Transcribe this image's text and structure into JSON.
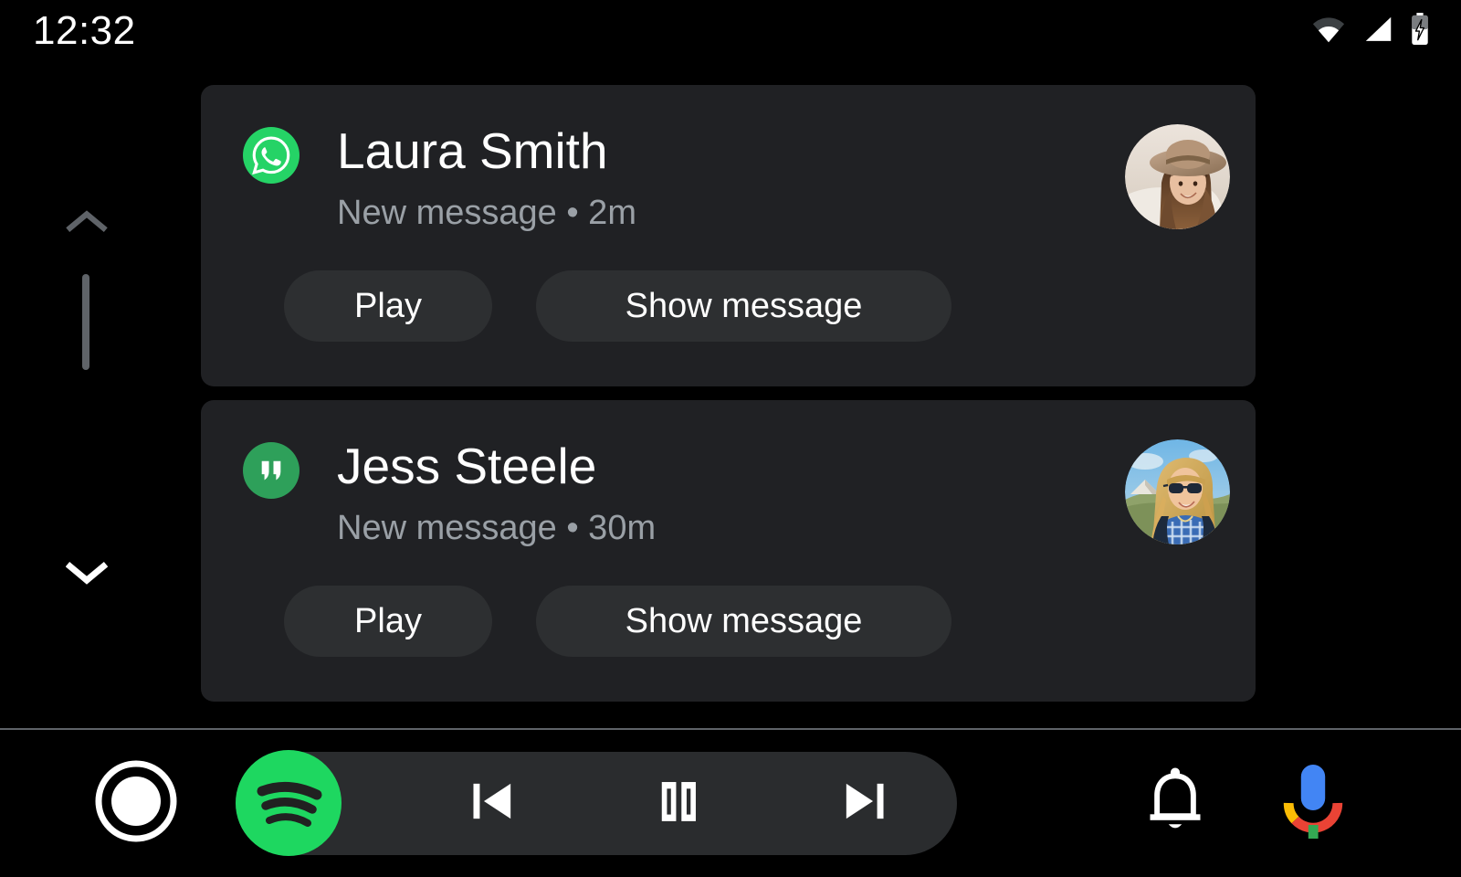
{
  "status_bar": {
    "clock": "12:32",
    "icons": [
      {
        "name": "wifi-icon",
        "label": "Wi-Fi"
      },
      {
        "name": "cellular-signal-icon",
        "label": "Cellular signal"
      },
      {
        "name": "battery-charging-icon",
        "label": "Battery charging"
      }
    ]
  },
  "scroll": {
    "up_icon": "chevron-up-icon",
    "down_icon": "chevron-down-icon",
    "up_enabled": false,
    "down_enabled": true,
    "thumb_position_pct": 0,
    "colors": {
      "up_chevron": "#5f6368",
      "down_chevron": "#ffffff",
      "thumb": "#5f6368"
    }
  },
  "notifications": [
    {
      "app_icon": "whatsapp-icon",
      "app_color": "#25D366",
      "sender": "Laura Smith",
      "subtitle": "New message • 2m",
      "avatar_name": "avatar-laura-smith",
      "actions": [
        {
          "label": "Play",
          "name": "play-button"
        },
        {
          "label": "Show message",
          "name": "show-message-button"
        }
      ]
    },
    {
      "app_icon": "hangouts-icon",
      "app_color": "#2EA05A",
      "sender": "Jess Steele",
      "subtitle": "New message • 30m",
      "avatar_name": "avatar-jess-steele",
      "actions": [
        {
          "label": "Play",
          "name": "play-button"
        },
        {
          "label": "Show message",
          "name": "show-message-button"
        }
      ]
    }
  ],
  "bottom_bar": {
    "home": {
      "name": "home-button",
      "icon": "home-circle-icon"
    },
    "media": {
      "app_icon": "spotify-icon",
      "app_color": "#1ED760",
      "controls": [
        {
          "name": "previous-track-button",
          "icon": "skip-previous-icon"
        },
        {
          "name": "pause-button",
          "icon": "pause-icon"
        },
        {
          "name": "next-track-button",
          "icon": "skip-next-icon"
        }
      ]
    },
    "notifications_button": {
      "name": "notifications-button",
      "icon": "bell-icon"
    },
    "assistant_button": {
      "name": "assistant-button",
      "icon": "google-mic-icon"
    }
  },
  "theme": {
    "background": "#000000",
    "card_bg": "#202124",
    "button_bg": "#2d2f31",
    "text_primary": "#ffffff",
    "text_secondary": "#9aa0a6",
    "separator": "#5f6368"
  }
}
